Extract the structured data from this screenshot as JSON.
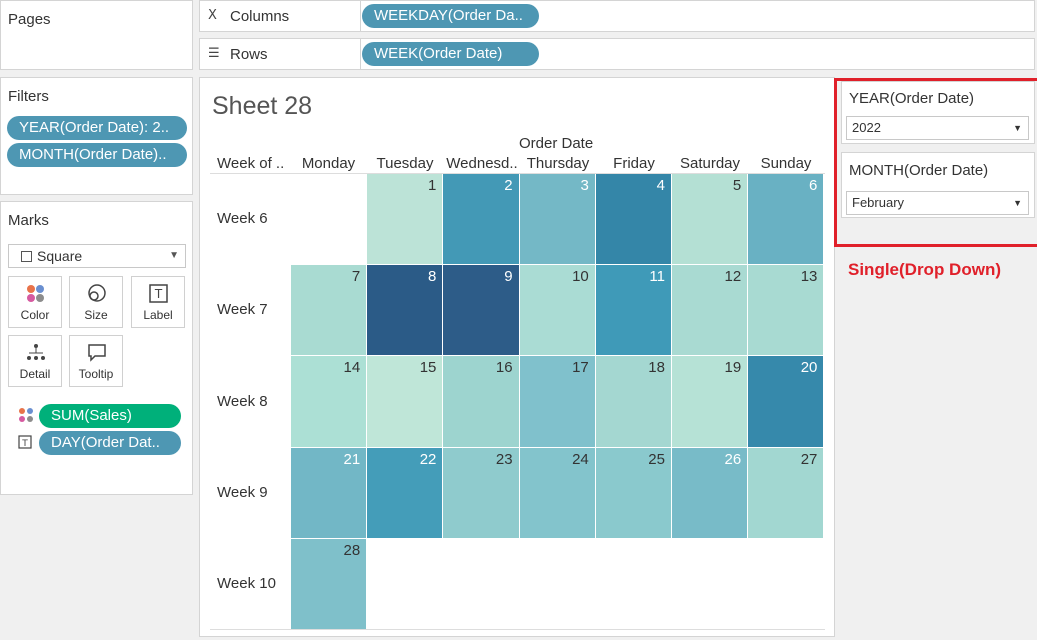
{
  "pages": {
    "title": "Pages"
  },
  "shelves": {
    "columns_label": "Columns",
    "columns_pill": "WEEKDAY(Order Da..",
    "rows_label": "Rows",
    "rows_pill": "WEEK(Order Date)"
  },
  "filters": {
    "title": "Filters",
    "items": [
      "YEAR(Order Date): 2..",
      "MONTH(Order Date).."
    ]
  },
  "marks": {
    "title": "Marks",
    "mark_type": "Square",
    "buttons": [
      "Color",
      "Size",
      "Label",
      "Detail",
      "Tooltip"
    ],
    "fields": [
      {
        "icon": "color-dots-icon",
        "label": "SUM(Sales)",
        "color": "#00b07a"
      },
      {
        "icon": "text-label-icon",
        "label": "DAY(Order Dat..",
        "color": "#4e97b3"
      }
    ]
  },
  "sheet": {
    "title": "Sheet 28",
    "column_group_header": "Order Date",
    "row_header": "Week of ..",
    "weekdays": [
      "Monday",
      "Tuesday",
      "Wednesd..",
      "Thursday",
      "Friday",
      "Saturday",
      "Sunday"
    ],
    "weeks": [
      "Week 6",
      "Week 7",
      "Week 8",
      "Week 9",
      "Week 10"
    ]
  },
  "chart_data": {
    "type": "heatmap",
    "title": "Sheet 28",
    "columns": [
      "Monday",
      "Tuesday",
      "Wednesd..",
      "Thursday",
      "Friday",
      "Saturday",
      "Sunday"
    ],
    "rows": [
      "Week 6",
      "Week 7",
      "Week 8",
      "Week 9",
      "Week 10"
    ],
    "cells": [
      {
        "week": 0,
        "col": 1,
        "day": "1",
        "color": "#bce3d7"
      },
      {
        "week": 0,
        "col": 2,
        "day": "2",
        "color": "#4399b6"
      },
      {
        "week": 0,
        "col": 3,
        "day": "3",
        "color": "#74b8c6"
      },
      {
        "week": 0,
        "col": 4,
        "day": "4",
        "color": "#3486a8"
      },
      {
        "week": 0,
        "col": 5,
        "day": "5",
        "color": "#b4e0d4"
      },
      {
        "week": 0,
        "col": 6,
        "day": "6",
        "color": "#69b1c3"
      },
      {
        "week": 1,
        "col": 0,
        "day": "7",
        "color": "#a9dbd2"
      },
      {
        "week": 1,
        "col": 1,
        "day": "8",
        "color": "#2b5b87"
      },
      {
        "week": 1,
        "col": 2,
        "day": "9",
        "color": "#2d5c88"
      },
      {
        "week": 1,
        "col": 3,
        "day": "10",
        "color": "#aadcd4"
      },
      {
        "week": 1,
        "col": 4,
        "day": "11",
        "color": "#3f9ab8"
      },
      {
        "week": 1,
        "col": 5,
        "day": "12",
        "color": "#a9dad2"
      },
      {
        "week": 1,
        "col": 6,
        "day": "13",
        "color": "#a8dad2"
      },
      {
        "week": 2,
        "col": 0,
        "day": "14",
        "color": "#ace0d5"
      },
      {
        "week": 2,
        "col": 1,
        "day": "15",
        "color": "#bfe6d8"
      },
      {
        "week": 2,
        "col": 2,
        "day": "16",
        "color": "#9dd4cf"
      },
      {
        "week": 2,
        "col": 3,
        "day": "17",
        "color": "#80c1cc"
      },
      {
        "week": 2,
        "col": 4,
        "day": "18",
        "color": "#a4d7d1"
      },
      {
        "week": 2,
        "col": 5,
        "day": "19",
        "color": "#b6e2d6"
      },
      {
        "week": 2,
        "col": 6,
        "day": "20",
        "color": "#3689ab"
      },
      {
        "week": 3,
        "col": 0,
        "day": "21",
        "color": "#72b7c6"
      },
      {
        "week": 3,
        "col": 1,
        "day": "22",
        "color": "#449db9"
      },
      {
        "week": 3,
        "col": 2,
        "day": "23",
        "color": "#8fcbcd"
      },
      {
        "week": 3,
        "col": 3,
        "day": "24",
        "color": "#83c4cc"
      },
      {
        "week": 3,
        "col": 4,
        "day": "25",
        "color": "#8ac9cd"
      },
      {
        "week": 3,
        "col": 5,
        "day": "26",
        "color": "#78bbc8"
      },
      {
        "week": 3,
        "col": 6,
        "day": "27",
        "color": "#a2d7d1"
      },
      {
        "week": 4,
        "col": 0,
        "day": "28",
        "color": "#7fc0ca"
      }
    ]
  },
  "right_filters": [
    {
      "title": "YEAR(Order Date)",
      "value": "2022"
    },
    {
      "title": "MONTH(Order Date)",
      "value": "February"
    }
  ],
  "annotation": "Single(Drop Down)"
}
